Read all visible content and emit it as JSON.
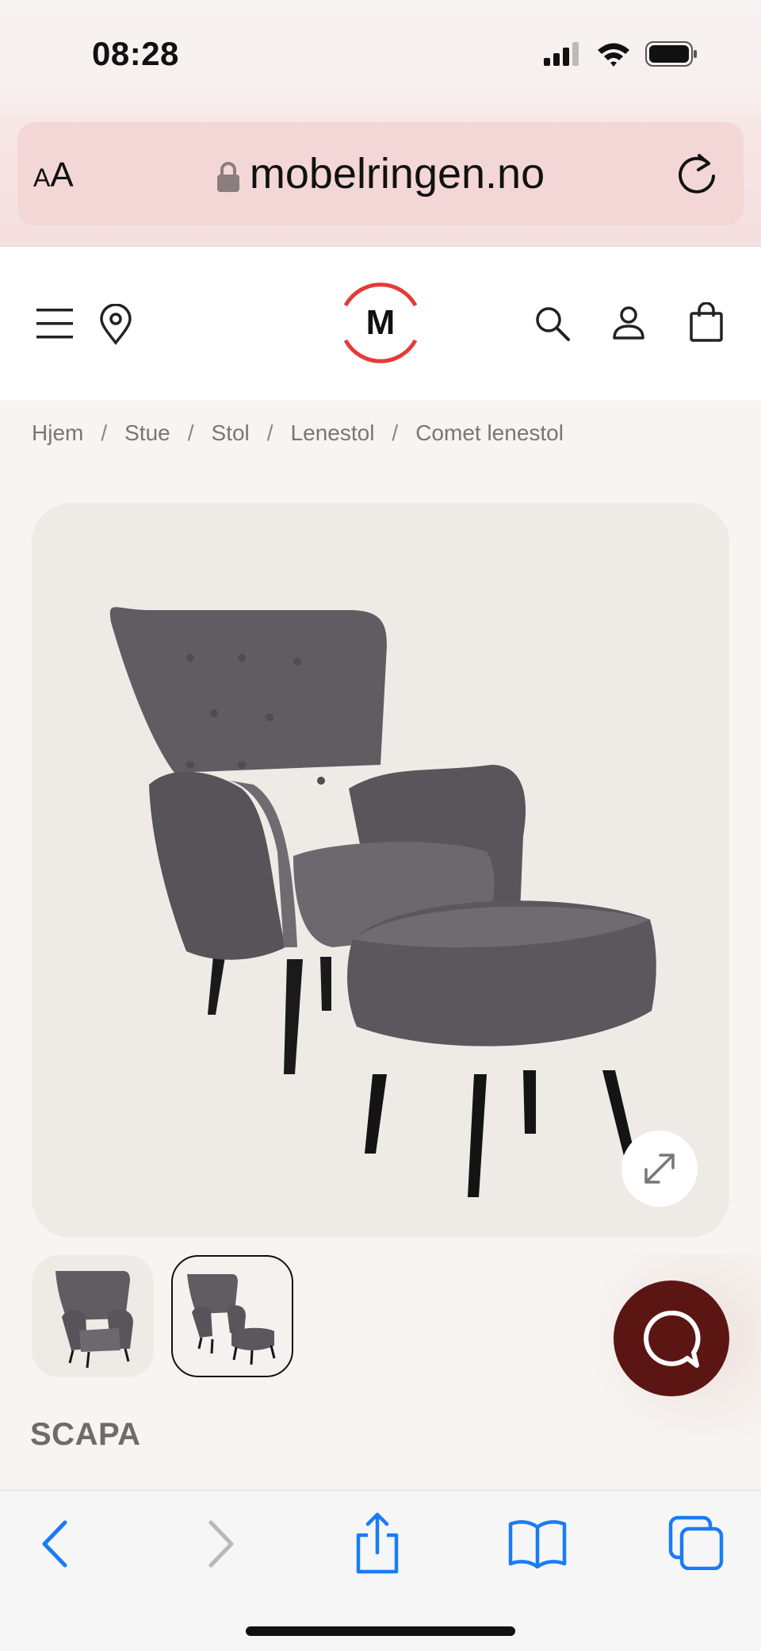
{
  "status_bar": {
    "time": "08:28"
  },
  "browser": {
    "text_size_label_small": "A",
    "text_size_label_large": "A",
    "url": "mobelringen.no"
  },
  "header": {
    "logo_letter": "M"
  },
  "breadcrumb": {
    "items": [
      "Hjem",
      "Stue",
      "Stol",
      "Lenestol",
      "Comet lenestol"
    ],
    "separator": "/"
  },
  "product": {
    "brand": "SCAPA"
  },
  "colors": {
    "logo_ring": "#e43b38",
    "chat_button": "#5b1614",
    "toolbar_blue": "#1a7cf5",
    "url_bar_bg": "#f3d7d6"
  },
  "icons": {
    "header": [
      "menu-icon",
      "location-pin-icon",
      "search-icon",
      "user-icon",
      "bag-icon"
    ],
    "toolbar": [
      "back-icon",
      "forward-icon",
      "share-icon",
      "bookmarks-icon",
      "tabs-icon"
    ]
  }
}
